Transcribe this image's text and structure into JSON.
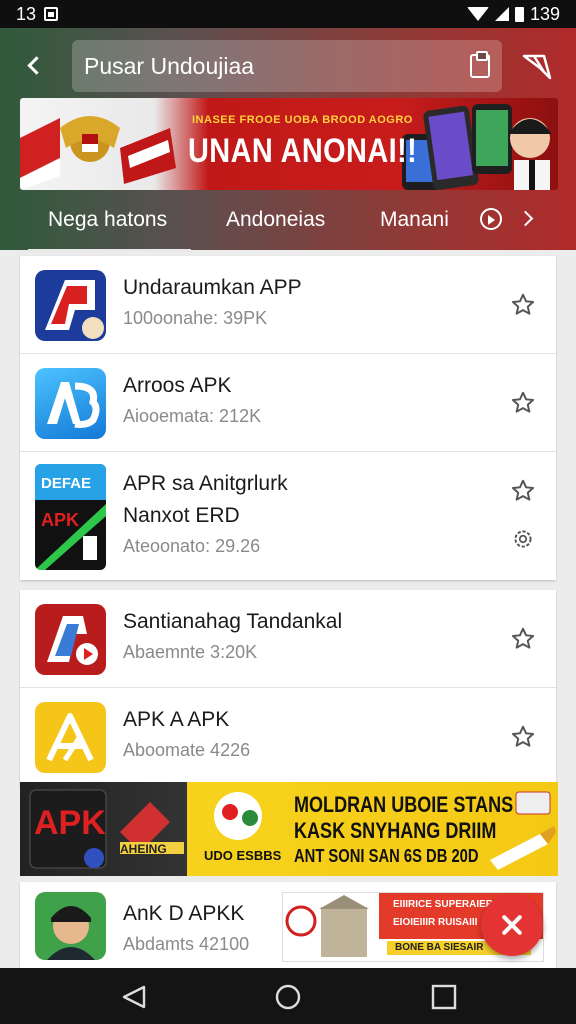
{
  "status_bar": {
    "time": "13",
    "battery_text": "139"
  },
  "header": {
    "search_query": "Pusar Undoujiaa",
    "banner": {
      "tagline": "INASEE FROOE UOBA BROOD AOGRO",
      "title": "UNAN ANONAI!!"
    },
    "tabs": [
      {
        "label": "Nega hatons"
      },
      {
        "label": "Andoneias"
      },
      {
        "label": "Manani"
      }
    ]
  },
  "apps": [
    {
      "name": "Undaraumkan APP",
      "meta": "100oonahe: 39PK"
    },
    {
      "name": "Arroos APK",
      "meta": "Aiooemata: 212K"
    },
    {
      "name_line1": "APR sa Anitgrlurk",
      "name_line2": "Nanxot ERD",
      "meta": "Ateoonato: 29.26",
      "icon_text_top": "DEFAE",
      "icon_text_bottom": "APK"
    },
    {
      "name": "Santianahag Tandankal",
      "meta": "Abaemnte 3:20K"
    },
    {
      "name": "APK A APK",
      "meta": "Aboomate 4226"
    },
    {
      "name": "AnK D APKK",
      "meta": "Abdamts 42100"
    }
  ],
  "promo": {
    "apk": "APK",
    "badge": "AHEING",
    "line1": "MOLDRAN UBOIE STANS",
    "line2": "KASK SNYHANG DRIIM",
    "line3": "ANT SONI SAN 6S DB 20D",
    "left_tag": "UDO ESBBS"
  },
  "mini_ad": {
    "line1": "EIIIRICE SUPERAIER",
    "line2": "EIOIEIIIR RUISAIII",
    "button": "BONE BA SIESAIR"
  },
  "colors": {
    "accent": "#e43333",
    "header_left": "#2f5a3a",
    "header_right": "#b02a2a",
    "promo_yellow": "#f7d21c"
  }
}
